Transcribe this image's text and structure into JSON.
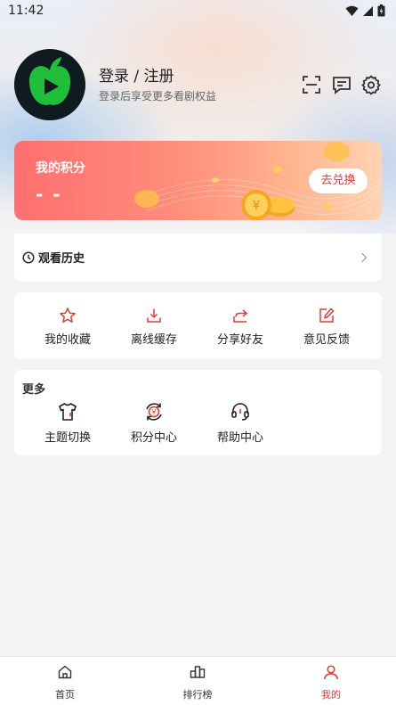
{
  "status_bar": {
    "time": "11:42"
  },
  "header": {
    "login_title": "登录 / 注册",
    "login_subtitle": "登录后享受更多看剧权益",
    "icons": [
      "scan-icon",
      "message-icon",
      "settings-icon"
    ]
  },
  "points_card": {
    "title": "我的积分",
    "value": "- -",
    "redeem_label": "去兑换"
  },
  "history": {
    "label": "观看历史"
  },
  "quick_actions": [
    {
      "label": "我的收藏",
      "icon": "star-icon"
    },
    {
      "label": "离线缓存",
      "icon": "download-icon"
    },
    {
      "label": "分享好友",
      "icon": "share-icon"
    },
    {
      "label": "意见反馈",
      "icon": "feedback-icon"
    }
  ],
  "more": {
    "title": "更多",
    "items": [
      {
        "label": "主题切换",
        "icon": "theme-shirt-icon"
      },
      {
        "label": "积分中心",
        "icon": "points-center-icon"
      },
      {
        "label": "帮助中心",
        "icon": "headset-icon"
      }
    ]
  },
  "bottom_nav": {
    "items": [
      {
        "label": "首页",
        "icon": "home-icon"
      },
      {
        "label": "排行榜",
        "icon": "ranking-icon"
      },
      {
        "label": "我的",
        "icon": "profile-icon"
      }
    ],
    "active": "我的"
  },
  "colors": {
    "accent": "#e53935",
    "brand_green": "#1fbf3a"
  }
}
